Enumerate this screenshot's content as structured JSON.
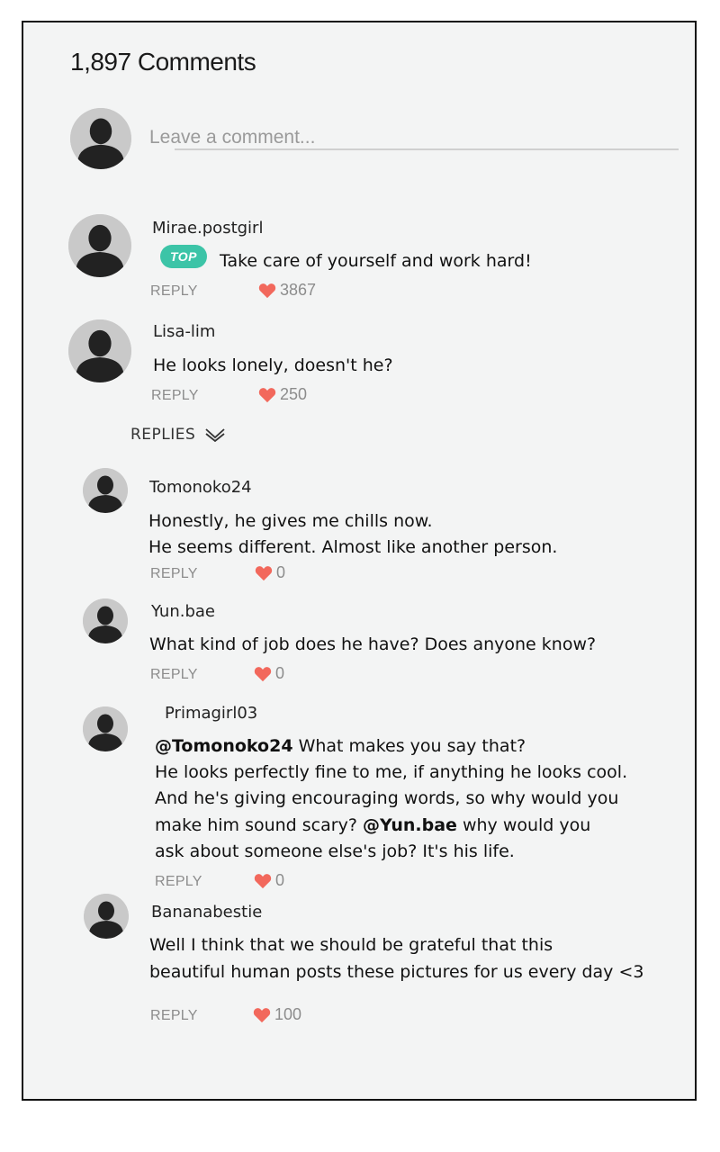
{
  "header": {
    "title": "1,897 Comments"
  },
  "composer": {
    "placeholder": "Leave a comment..."
  },
  "reply_label": "REPLY",
  "replies_toggle_label": "REPLIES",
  "colors": {
    "accent_teal": "#3cc4a7",
    "heart": "#f2685c",
    "muted_text": "#8c8c8c"
  },
  "comments": [
    {
      "username": "Mirae.postgirl",
      "badge": "TOP",
      "lines": [
        "Take care of yourself and work hard!"
      ],
      "likes": "3867"
    },
    {
      "username": "Lisa-lim",
      "lines": [
        "He looks lonely, doesn't he?"
      ],
      "likes": "250"
    }
  ],
  "replies": [
    {
      "username": "Tomonoko24",
      "lines": [
        "Honestly, he gives me chills now.",
        "He seems different. Almost like another person."
      ],
      "likes": "0"
    },
    {
      "username": "Yun.bae",
      "lines": [
        "What kind of job does he have? Does anyone know?"
      ],
      "likes": "0"
    },
    {
      "username": "Primagirl03",
      "mention1": "@Tomonoko24",
      "line1_rest": " What makes you say that?",
      "line2": "He looks perfectly fine to me, if anything he looks cool.",
      "line3": "And he's giving encouraging words, so why would you",
      "line4_pre": "make him sound scary? ",
      "mention2": "@Yun.bae",
      "line4_post": " why would you",
      "line5": "ask about someone else's job? It's his life.",
      "likes": "0"
    },
    {
      "username": "Bananabestie",
      "lines": [
        "Well I think that we should be grateful that this",
        "beautiful human posts these pictures for us every day <3"
      ],
      "likes": "100"
    }
  ]
}
